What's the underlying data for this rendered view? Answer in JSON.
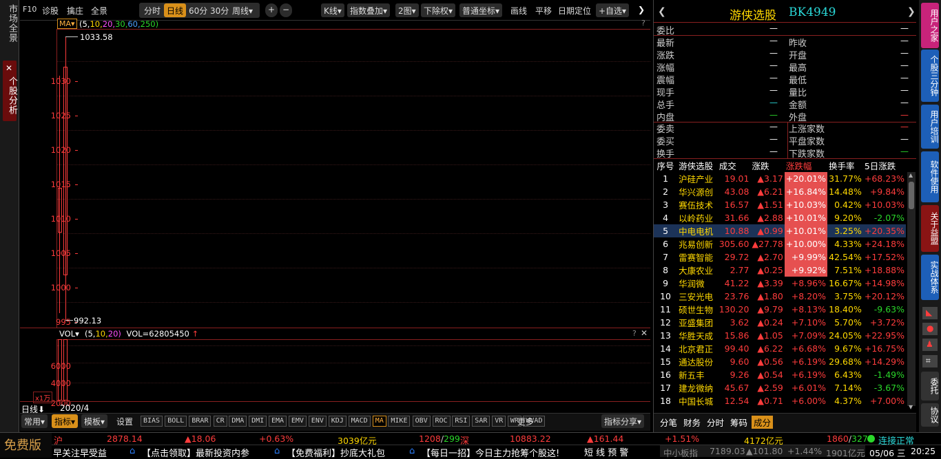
{
  "left_tabs": {
    "market": "市场全景",
    "analysis": "个股分析",
    "close": "✕"
  },
  "toolbar": {
    "f10": "F10",
    "zhenlu": "诊股",
    "qingzhuang": "擒庄",
    "quanjing": "全景",
    "fenshi": "分时",
    "rixian": "日线",
    "m60": "60分",
    "m30": "30分",
    "zhouxian": "周线▾",
    "plus": "+",
    "minus": "−",
    "kxian": "K线▾",
    "zhishu": "指数叠加▾",
    "tu2": "2图▾",
    "xiachuquan": "下除权▾",
    "putong": "普通坐标▾",
    "huaxian": "画线",
    "pingyi": "平移",
    "riqi": "日期定位",
    "zixuan": "+自选▾",
    "more": "❯"
  },
  "main_chart": {
    "indicator": "MA▾",
    "params": "(5,",
    "p10": "10,",
    "p20": "20,",
    "p30": "30,",
    "p60": "60,",
    "p250": "250)",
    "help": "?",
    "high": "1033.58",
    "low": "992.13",
    "y_ticks": [
      "1030",
      "1025",
      "1020",
      "1015",
      "1010",
      "1005",
      "1000",
      "995"
    ]
  },
  "vol_chart": {
    "indicator": "VOL▾",
    "params": "(5,",
    "p10": "10,",
    "p20": "20)",
    "value": "VOL=62805450",
    "arrow": "↑",
    "help": "?",
    "close": "✕",
    "y_ticks": [
      "6000",
      "4000",
      "2000"
    ],
    "unit": "x1万"
  },
  "chart_footer": {
    "period": "日线⬇",
    "date": "2020/4"
  },
  "indicator_bar": {
    "changyong": "常用▾",
    "zhibiao": "指标▾",
    "moban": "模板▾",
    "shezhi": "设置",
    "items": [
      "BIAS",
      "BOLL",
      "BRAR",
      "CR",
      "DMA",
      "DMI",
      "EMA",
      "EMV",
      "ENV",
      "KDJ",
      "MACD",
      "MA",
      "MIKE",
      "OBV",
      "ROC",
      "RSI",
      "SAR",
      "VR",
      "WR",
      "WVAD"
    ],
    "more": "更多",
    "share": "指标分享▾"
  },
  "panel": {
    "prev": "❮",
    "title": "游侠选股",
    "code": "BK4949",
    "next": "❯",
    "weibi": "委比",
    "dash": "—",
    "left_labels": [
      "最新",
      "涨跌",
      "涨幅",
      "震幅",
      "现手",
      "总手",
      "内盘"
    ],
    "right_labels": [
      "昨收",
      "开盘",
      "最高",
      "最低",
      "量比",
      "金额",
      "外盘"
    ],
    "left2": [
      "委卖",
      "委买",
      "换手"
    ],
    "right2": [
      "上涨家数",
      "平盘家数",
      "下跌家数"
    ],
    "headers": [
      "序号",
      "游侠选股",
      "成交",
      "涨跌",
      "涨跌幅",
      "换手率",
      "5日涨跌"
    ],
    "rows": [
      [
        "1",
        "沪硅产业",
        "19.01",
        "▲3.17",
        "+20.01%",
        "31.77%",
        "+68.23%"
      ],
      [
        "2",
        "华兴源创",
        "43.08",
        "▲6.21",
        "+16.84%",
        "14.48%",
        "+9.84%"
      ],
      [
        "3",
        "赛伍技术",
        "16.57",
        "▲1.51",
        "+10.03%",
        "0.42%",
        "+10.03%"
      ],
      [
        "4",
        "以岭药业",
        "31.66",
        "▲2.88",
        "+10.01%",
        "9.20%",
        "-2.07%"
      ],
      [
        "5",
        "中电电机",
        "10.88",
        "▲0.99",
        "+10.01%",
        "3.25%",
        "+20.35%"
      ],
      [
        "6",
        "兆易创新",
        "305.60",
        "▲27.78",
        "+10.00%",
        "4.33%",
        "+24.18%"
      ],
      [
        "7",
        "雷赛智能",
        "29.72",
        "▲2.70",
        "+9.99%",
        "42.54%",
        "+17.52%"
      ],
      [
        "8",
        "大康农业",
        "2.77",
        "▲0.25",
        "+9.92%",
        "7.51%",
        "+18.88%"
      ],
      [
        "9",
        "华润微",
        "41.22",
        "▲3.39",
        "+8.96%",
        "16.67%",
        "+14.98%"
      ],
      [
        "10",
        "三安光电",
        "23.76",
        "▲1.80",
        "+8.20%",
        "3.75%",
        "+20.12%"
      ],
      [
        "11",
        "硕世生物",
        "130.20",
        "▲9.79",
        "+8.13%",
        "18.40%",
        "-9.63%"
      ],
      [
        "12",
        "亚盛集团",
        "3.62",
        "▲0.24",
        "+7.10%",
        "5.70%",
        "+3.72%"
      ],
      [
        "13",
        "华胜天成",
        "15.86",
        "▲1.05",
        "+7.09%",
        "24.05%",
        "+22.95%"
      ],
      [
        "14",
        "北京君正",
        "99.40",
        "▲6.22",
        "+6.68%",
        "9.67%",
        "+16.75%"
      ],
      [
        "15",
        "通达股份",
        "9.60",
        "▲0.56",
        "+6.19%",
        "29.68%",
        "+14.29%"
      ],
      [
        "16",
        "新五丰",
        "9.26",
        "▲0.54",
        "+6.19%",
        "6.43%",
        "-1.49%"
      ],
      [
        "17",
        "建龙微纳",
        "45.67",
        "▲2.59",
        "+6.01%",
        "7.14%",
        "-3.67%"
      ],
      [
        "18",
        "中国长城",
        "12.54",
        "▲0.71",
        "+6.00%",
        "4.37%",
        "+7.00%"
      ]
    ],
    "tabs": [
      "分笔",
      "财务",
      "分时",
      "筹码",
      "成分"
    ]
  },
  "right_tabs": [
    "用户之家",
    "个股三分钟",
    "用户培训",
    "软件使用",
    "关于益盟",
    "实战体系",
    "委托",
    "协议"
  ],
  "bottom": {
    "free": "免费版",
    "hu": "沪",
    "hu_idx": "2878.14",
    "hu_chg": "▲18.06",
    "hu_pct": "+0.63%",
    "hu_amt": "3039亿元",
    "hu_ud_up": "1208",
    "hu_ud_sep": "/",
    "hu_ud_dn": "299",
    "shen": "深",
    "sz_idx": "10883.22",
    "sz_chg": "▲161.44",
    "sz_pct": "+1.51%",
    "sz_amt": "4172亿元",
    "sz_ud_up": "1860",
    "sz_ud_sep": "/",
    "sz_ud_dn": "327",
    "conn": "连接正常",
    "ticker": [
      "早关注早受益",
      "【点击领取】最新投资内参",
      "【免费福利】抄底大礼包",
      "【每日一招】今日主力抢筹个股这!"
    ],
    "alert": "短 线 预 警",
    "zx": "中小板指",
    "zx_idx": "7189.03",
    "zx_chg": "▲101.80",
    "zx_pct": "+1.44%",
    "zx_amt": "1901亿元",
    "date": "05/06 三",
    "time": "20:25"
  }
}
